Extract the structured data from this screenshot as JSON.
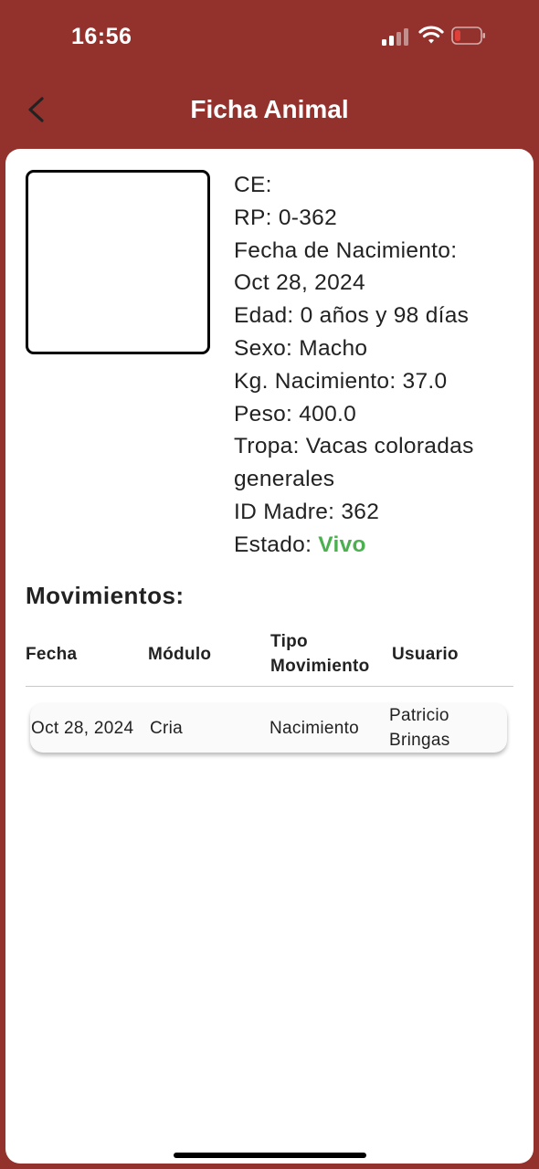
{
  "status_bar": {
    "time": "16:56",
    "signal_icon": "signal-icon",
    "wifi_icon": "wifi-icon",
    "battery_icon": "battery-low-icon",
    "battery_color": "#e0403a"
  },
  "header": {
    "title": "Ficha Animal",
    "back_icon": "chevron-left-icon",
    "background": "#93322d"
  },
  "animal": {
    "ce": "CE:",
    "rp": "RP: 0-362",
    "fecha_label": "Fecha de Nacimiento:",
    "fecha_value": "Oct 28, 2024",
    "edad": "Edad: 0 años y 98 días",
    "sexo": "Sexo: Macho",
    "kg_nacimiento": "Kg. Nacimiento: 37.0",
    "peso": "Peso: 400.0",
    "tropa": "Tropa: Vacas coloradas generales",
    "id_madre": "ID Madre: 362",
    "estado_label": "Estado: ",
    "estado_value": "Vivo",
    "estado_color": "#4caf50"
  },
  "movimientos": {
    "title": "Movimientos:",
    "columns": [
      "Fecha",
      "Módulo",
      "Tipo Movimiento",
      "Usuario"
    ],
    "rows": [
      {
        "fecha": "Oct 28, 2024",
        "modulo": "Cria",
        "tipo": "Nacimiento",
        "usuario": "Patricio Bringas"
      }
    ]
  }
}
